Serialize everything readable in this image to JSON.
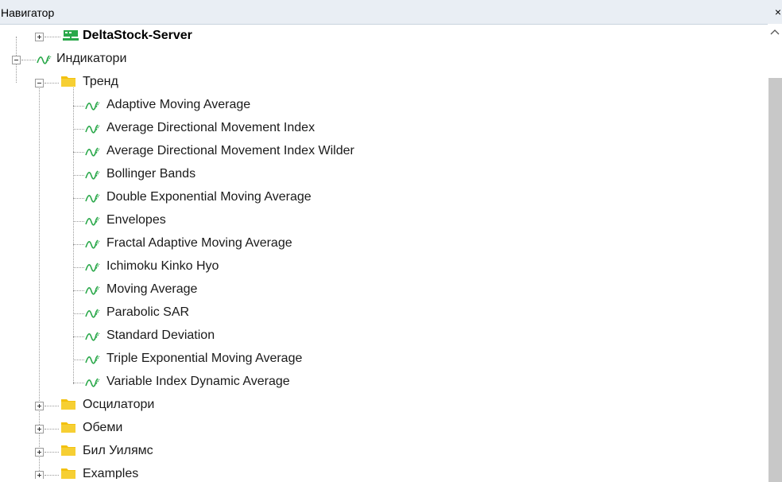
{
  "window": {
    "title": "Навигатор",
    "close_label": "×"
  },
  "tree": {
    "server": {
      "label": "DeltaStock-Server"
    },
    "indicators": {
      "label": "Индикатори",
      "trend": {
        "label": "Тренд",
        "items": [
          "Adaptive Moving Average",
          "Average Directional Movement Index",
          "Average Directional Movement Index Wilder",
          "Bollinger Bands",
          "Double Exponential Moving Average",
          "Envelopes",
          "Fractal Adaptive Moving Average",
          "Ichimoku Kinko Hyo",
          "Moving Average",
          "Parabolic SAR",
          "Standard Deviation",
          "Triple Exponential Moving Average",
          "Variable Index Dynamic Average"
        ]
      },
      "folders": [
        "Осцилатори",
        "Обеми",
        "Бил Уилямс",
        "Examples"
      ]
    }
  },
  "colors": {
    "folder": "#f3c10f",
    "indicator": "#2aa84a",
    "server": "#2aa84a"
  }
}
